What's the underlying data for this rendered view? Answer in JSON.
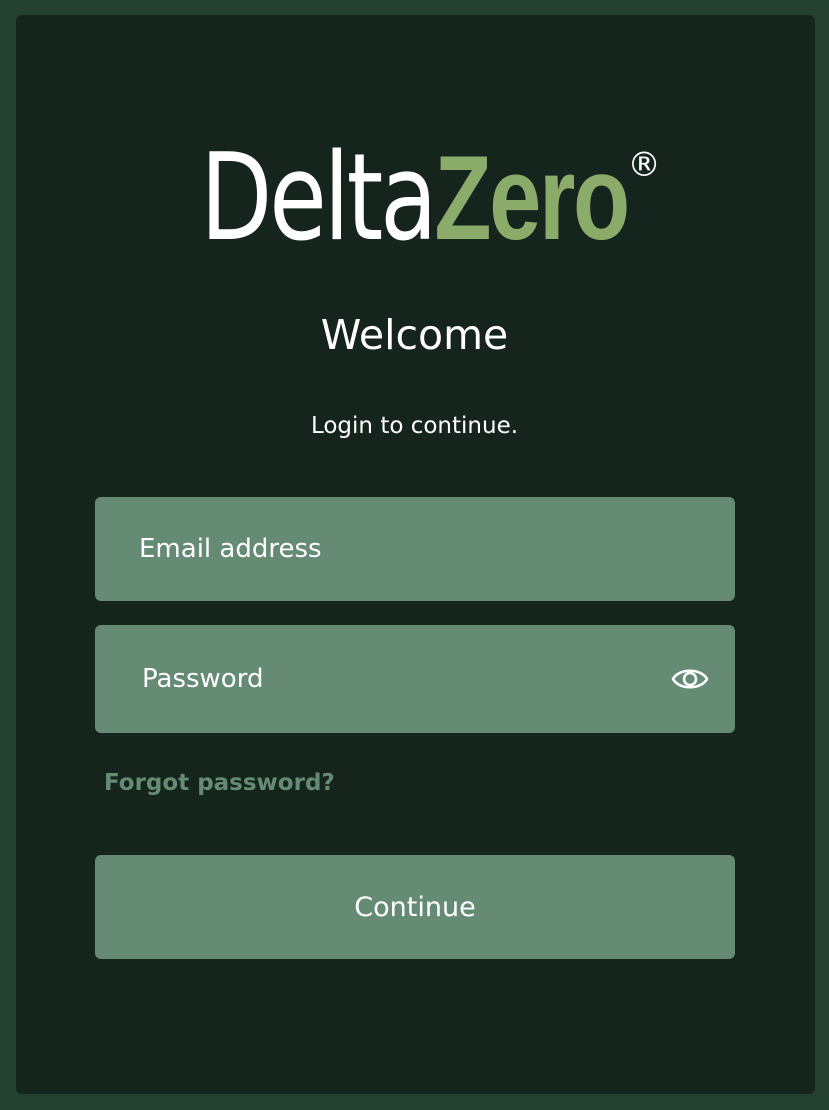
{
  "logo": {
    "text_light": "Delta",
    "text_bold": "Zero",
    "registered_mark": "®",
    "accent_color": "#8aab6a"
  },
  "heading": "Welcome",
  "subtitle": "Login to continue.",
  "form": {
    "email": {
      "placeholder": "Email address",
      "value": ""
    },
    "password": {
      "placeholder": "Password",
      "value": "",
      "toggle_icon": "eye-icon"
    },
    "forgot_password_label": "Forgot password?",
    "submit_label": "Continue"
  },
  "colors": {
    "background": "#24402f",
    "card": "#15241c",
    "field": "#658b75",
    "text": "#ffffff"
  }
}
